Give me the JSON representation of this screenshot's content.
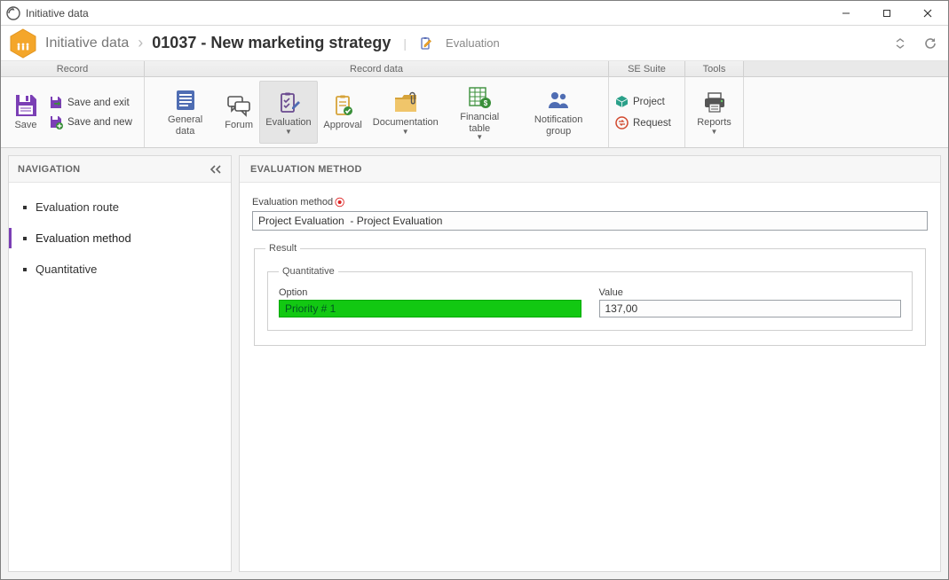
{
  "window": {
    "title": "Initiative data"
  },
  "breadcrumb": {
    "module": "Initiative data",
    "record": "01037 - New marketing strategy",
    "section": "Evaluation"
  },
  "ribbon": {
    "groups": {
      "record": "Record",
      "record_data": "Record data",
      "se_suite": "SE Suite",
      "tools": "Tools"
    },
    "save": "Save",
    "save_and_exit": "Save and exit",
    "save_and_new": "Save and new",
    "general_data": "General data",
    "forum": "Forum",
    "evaluation": "Evaluation",
    "approval": "Approval",
    "documentation": "Documentation",
    "financial_table": "Financial table",
    "notification_group": "Notification group",
    "project": "Project",
    "request": "Request",
    "reports": "Reports"
  },
  "navigation": {
    "title": "NAVIGATION",
    "items": [
      {
        "label": "Evaluation route"
      },
      {
        "label": "Evaluation method"
      },
      {
        "label": "Quantitative"
      }
    ],
    "active_index": 1
  },
  "main": {
    "title": "EVALUATION METHOD",
    "field_label": "Evaluation method",
    "field_value": "Project Evaluation  - Project Evaluation",
    "result_legend": "Result",
    "quant_legend": "Quantitative",
    "option_label": "Option",
    "option_value": "Priority # 1",
    "value_label": "Value",
    "value_value": "137,00"
  }
}
